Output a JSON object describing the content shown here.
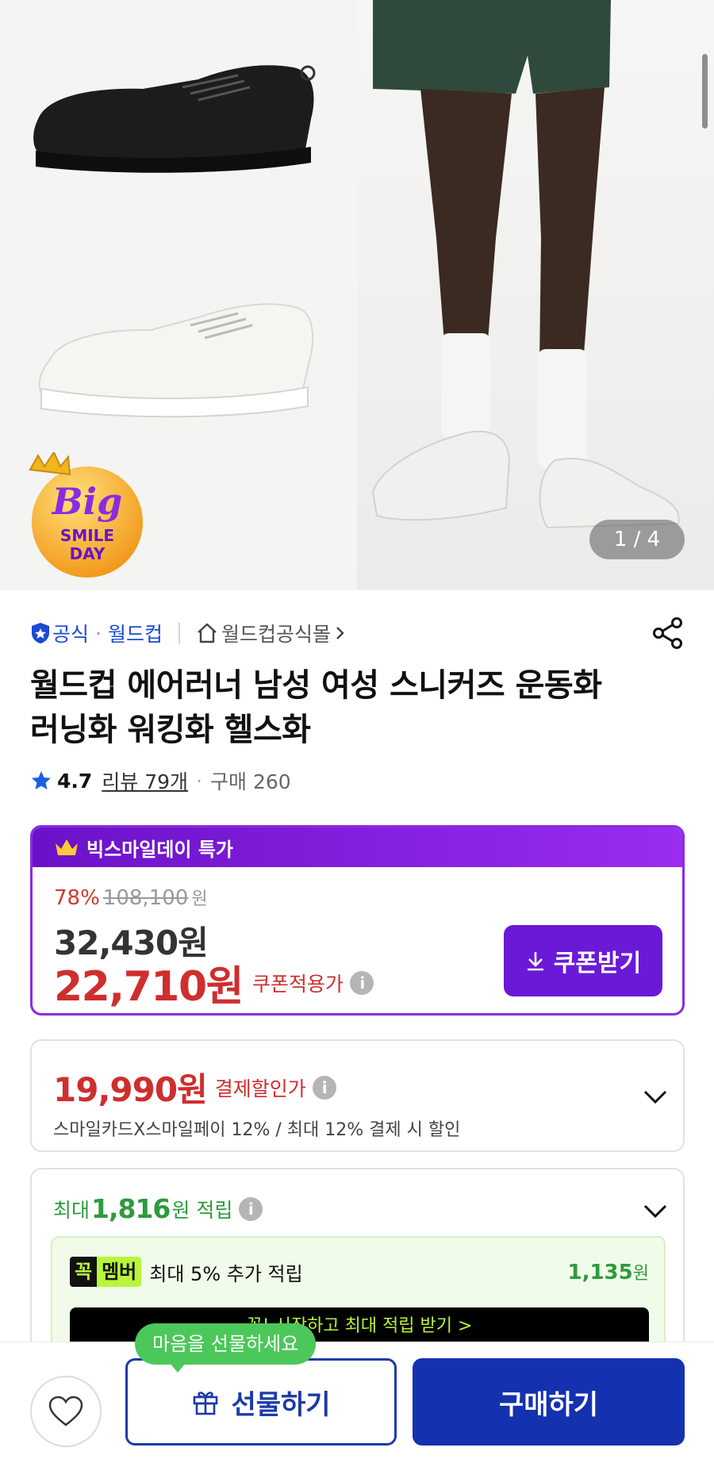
{
  "hero": {
    "page_counter": "1 / 4",
    "badge": {
      "line1": "Big",
      "line2": "SMILE",
      "line3": "DAY"
    }
  },
  "seller": {
    "official_label": "공식",
    "brand": "월드컵",
    "store_link": "월드컵공식몰"
  },
  "product": {
    "title": "월드컵 에어러너 남성 여성 스니커즈 운동화 러닝화 워킹화 헬스화",
    "rating": "4.7",
    "reviews": "리뷰 79개",
    "purchases": "구매 260"
  },
  "promo": {
    "header": "빅스마일데이 특가",
    "discount_pct": "78%",
    "original_price": "108,100",
    "original_unit": "원",
    "sale_price": "32,430원",
    "coupon_price": "22,710원",
    "coupon_label": "쿠폰적용가",
    "coupon_button": "쿠폰받기"
  },
  "payment": {
    "price": "19,990원",
    "label": "결제할인가",
    "description": "스마일카드X스마일페이 12% / 최대 12% 결제 시 할인"
  },
  "points": {
    "prefix": "최대",
    "amount": "1,816",
    "suffix": "원 적립",
    "member_tag_a": "꼭",
    "member_tag_b": "멤버",
    "member_text": "최대 5% 추가 적립",
    "member_amount": "1,135",
    "member_unit": "원",
    "member_cta": "꼭! 시작하고 최대 적립 받기 >"
  },
  "bottom": {
    "tooltip": "마음을 선물하세요",
    "gift_button": "선물하기",
    "buy_button": "구매하기"
  },
  "colors": {
    "brand_blue": "#1431b0",
    "promo_purple": "#8a2be2",
    "price_red": "#cf2e2e",
    "points_green": "#2e9a3e"
  },
  "icons": [
    "shield-star-icon",
    "home-icon",
    "chevron-right-icon",
    "share-icon",
    "star-icon",
    "crown-icon",
    "download-icon",
    "info-icon",
    "chevron-down-icon",
    "heart-icon",
    "gift-icon"
  ]
}
